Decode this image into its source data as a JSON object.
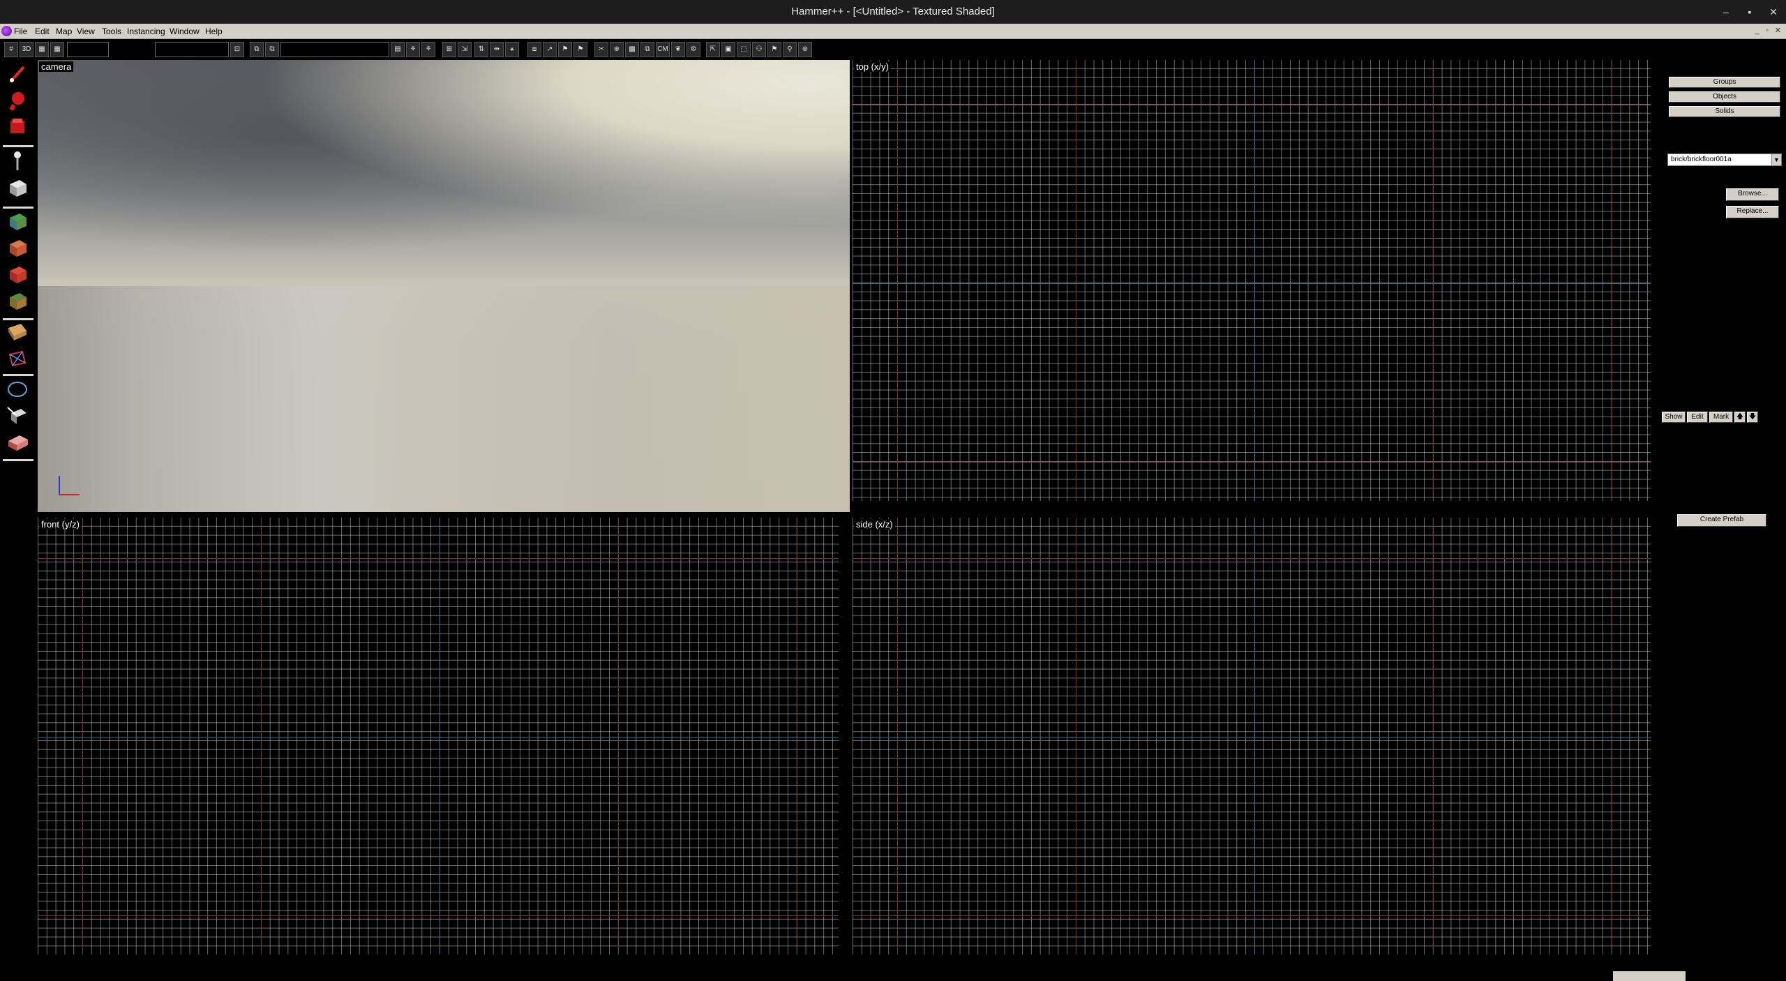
{
  "window": {
    "title": "Hammer++ - [<Untitled> - Textured Shaded]",
    "controls": [
      "–",
      "▪",
      "✕"
    ]
  },
  "menu": {
    "items": [
      "File",
      "Edit",
      "Map",
      "View",
      "Tools",
      "Instancing",
      "Window",
      "Help"
    ],
    "mdi_controls": "_ ▫ ✕"
  },
  "toolbar": {
    "buttons": [
      "grid-toggle",
      "3d-grid",
      "toggle-grid-snap",
      "carve",
      "undo",
      "redo"
    ],
    "labels": {
      "b_3d": "3D",
      "b_cm": "CM"
    }
  },
  "viewports": {
    "camera": {
      "label": "camera"
    },
    "top": {
      "label": "top (x/y)"
    },
    "front": {
      "label": "front (y/z)"
    },
    "side": {
      "label": "side (x/z)"
    }
  },
  "right_panel": {
    "select_groups": "Groups",
    "select_objects": "Objects",
    "select_solids": "Solids",
    "texture_value": "brick/brickfloor001a",
    "browse_label": "Browse...",
    "replace_label": "Replace...",
    "vis_show": "Show",
    "vis_edit": "Edit",
    "vis_mark": "Mark",
    "vis_up": "🡅",
    "vis_down": "🡇",
    "create_prefab_label": "Create Prefab"
  },
  "colors": {
    "grid_minor": "#c8c8c8",
    "grid_major": "#7a3b26",
    "grid_axis": "#2e6f8a",
    "ui_face": "#d4d0c8",
    "titlebar": "#1d1d1d"
  }
}
